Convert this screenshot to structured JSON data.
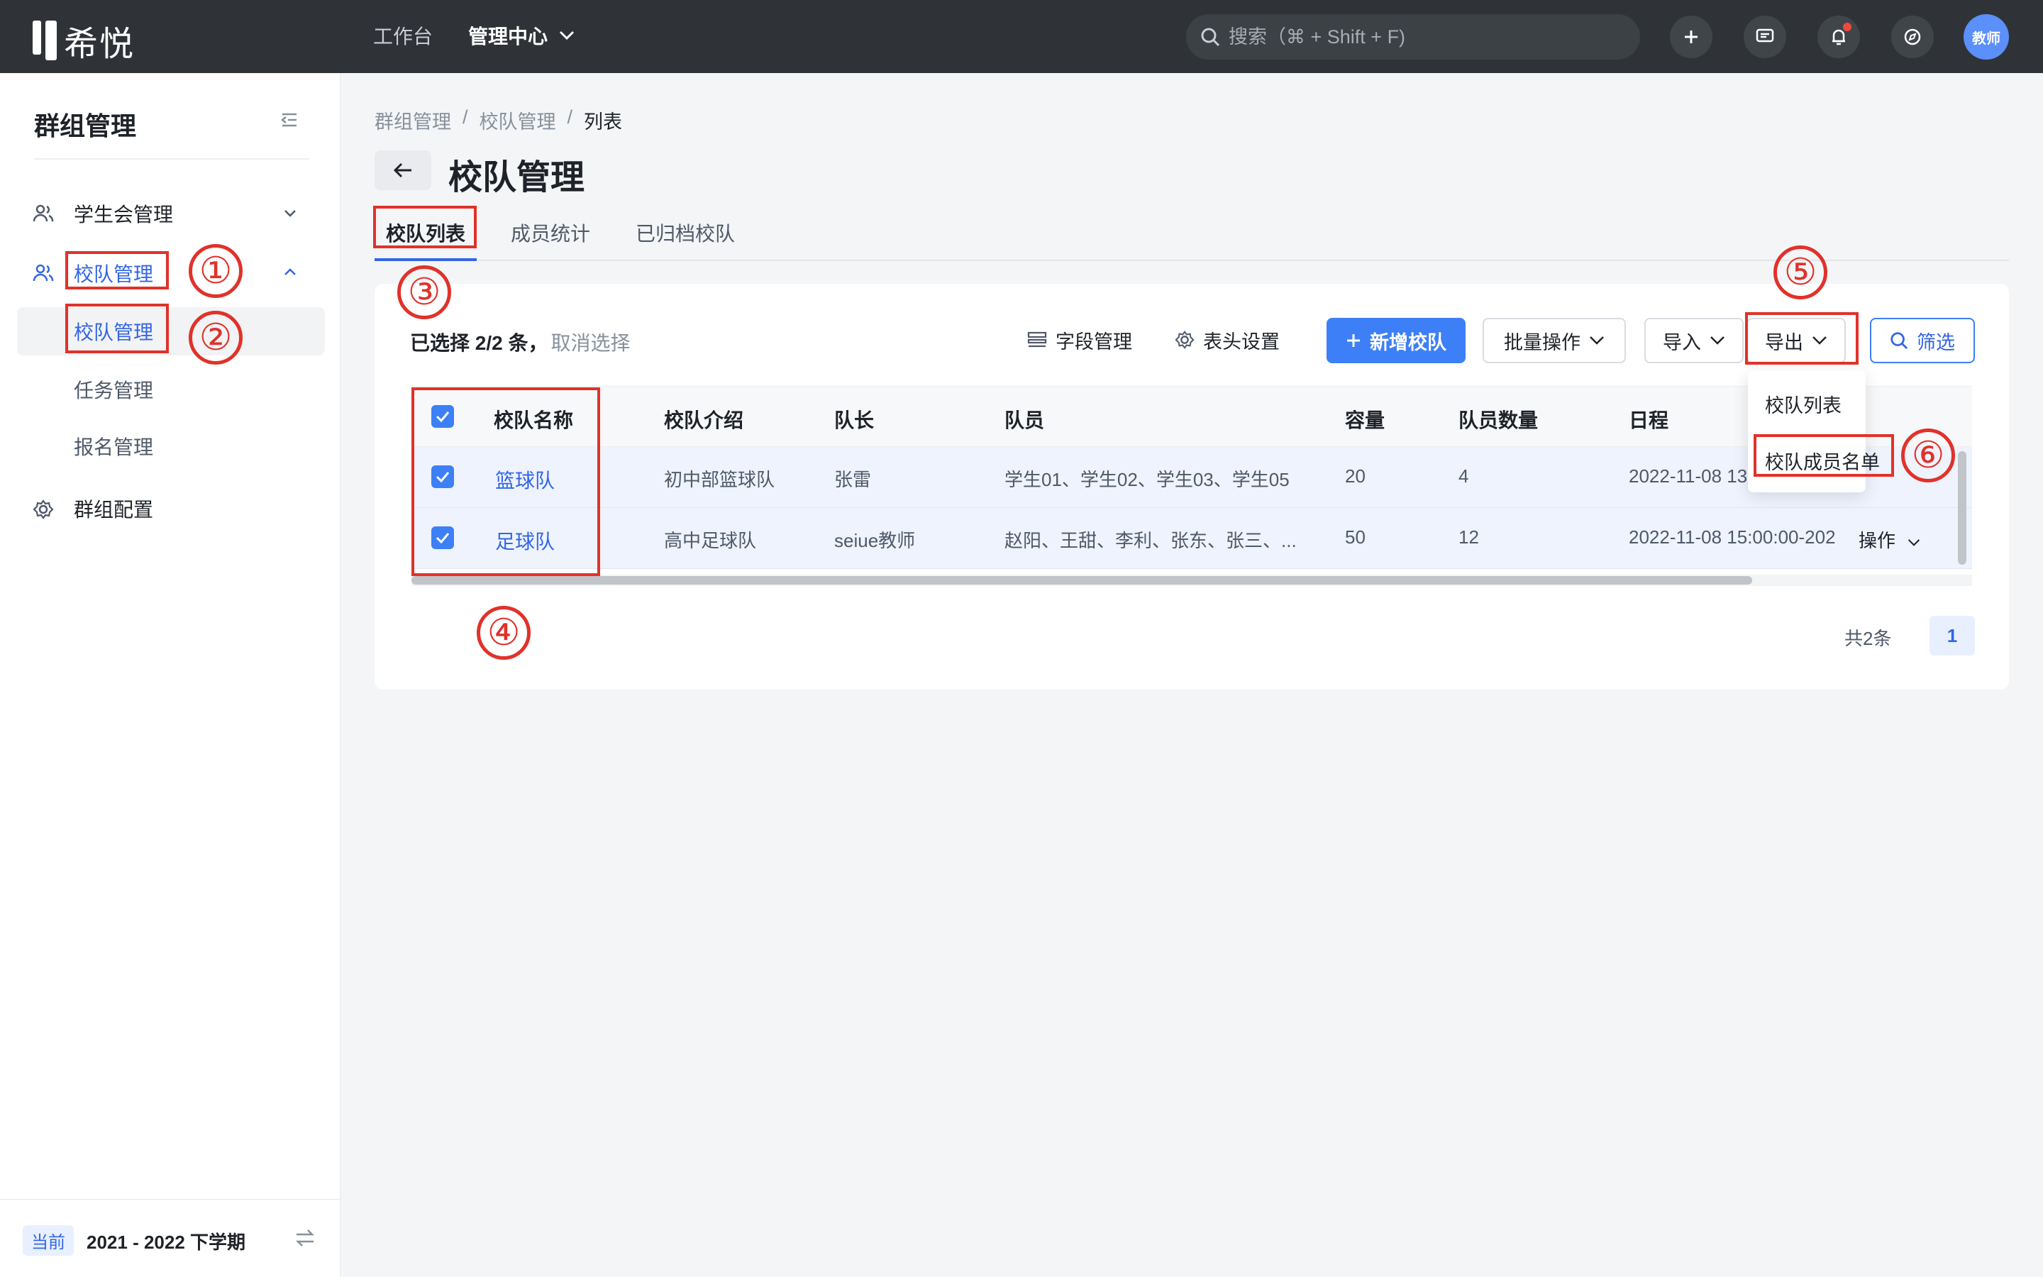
{
  "topbar": {
    "logo_text": "希悦",
    "nav": [
      "工作台",
      "管理中心"
    ],
    "search_placeholder": "搜索（⌘ + Shift + F)",
    "avatar_label": "教师"
  },
  "sidebar": {
    "title": "群组管理",
    "items": [
      {
        "label": "学生会管理"
      },
      {
        "label": "校队管理"
      },
      {
        "label": "校队管理"
      },
      {
        "label": "任务管理"
      },
      {
        "label": "报名管理"
      },
      {
        "label": "群组配置"
      }
    ],
    "footer": {
      "badge": "当前",
      "term": "2021 - 2022 下学期"
    }
  },
  "breadcrumb": [
    "群组管理",
    "/",
    "校队管理",
    "/",
    "列表"
  ],
  "page_title": "校队管理",
  "tabs": [
    "校队列表",
    "成员统计",
    "已归档校队"
  ],
  "toolbar": {
    "selected_prefix": "已选择 2/2 条，",
    "cancel": "取消选择",
    "field_mgmt": "字段管理",
    "header_settings": "表头设置",
    "add": "新增校队",
    "batch": "批量操作",
    "import": "导入",
    "export": "导出",
    "filter": "筛选"
  },
  "table": {
    "columns": [
      "校队名称",
      "校队介绍",
      "队长",
      "队员",
      "容量",
      "队员数量",
      "日程"
    ],
    "rows": [
      {
        "name": "篮球队",
        "intro": "初中部篮球队",
        "captain": "张雷",
        "members": "学生01、学生02、学生03、学生05",
        "capacity": "20",
        "count": "4",
        "schedule": "2022-11-08 13",
        "action": ""
      },
      {
        "name": "足球队",
        "intro": "高中足球队",
        "captain": "seiue教师",
        "members": "赵阳、王甜、李利、张东、张三、...",
        "capacity": "50",
        "count": "12",
        "schedule": "2022-11-08 15:00:00-202",
        "action": "操作"
      }
    ]
  },
  "pagination": {
    "total": "共2条",
    "page": "1"
  },
  "export_menu": [
    "校队列表",
    "校队成员名单"
  ],
  "annotations": [
    "①",
    "②",
    "③",
    "④",
    "⑤",
    "⑥"
  ],
  "colors": {
    "accent": "#3d7ff6",
    "highlight": "#e0322a",
    "topbar": "#2f3337"
  }
}
